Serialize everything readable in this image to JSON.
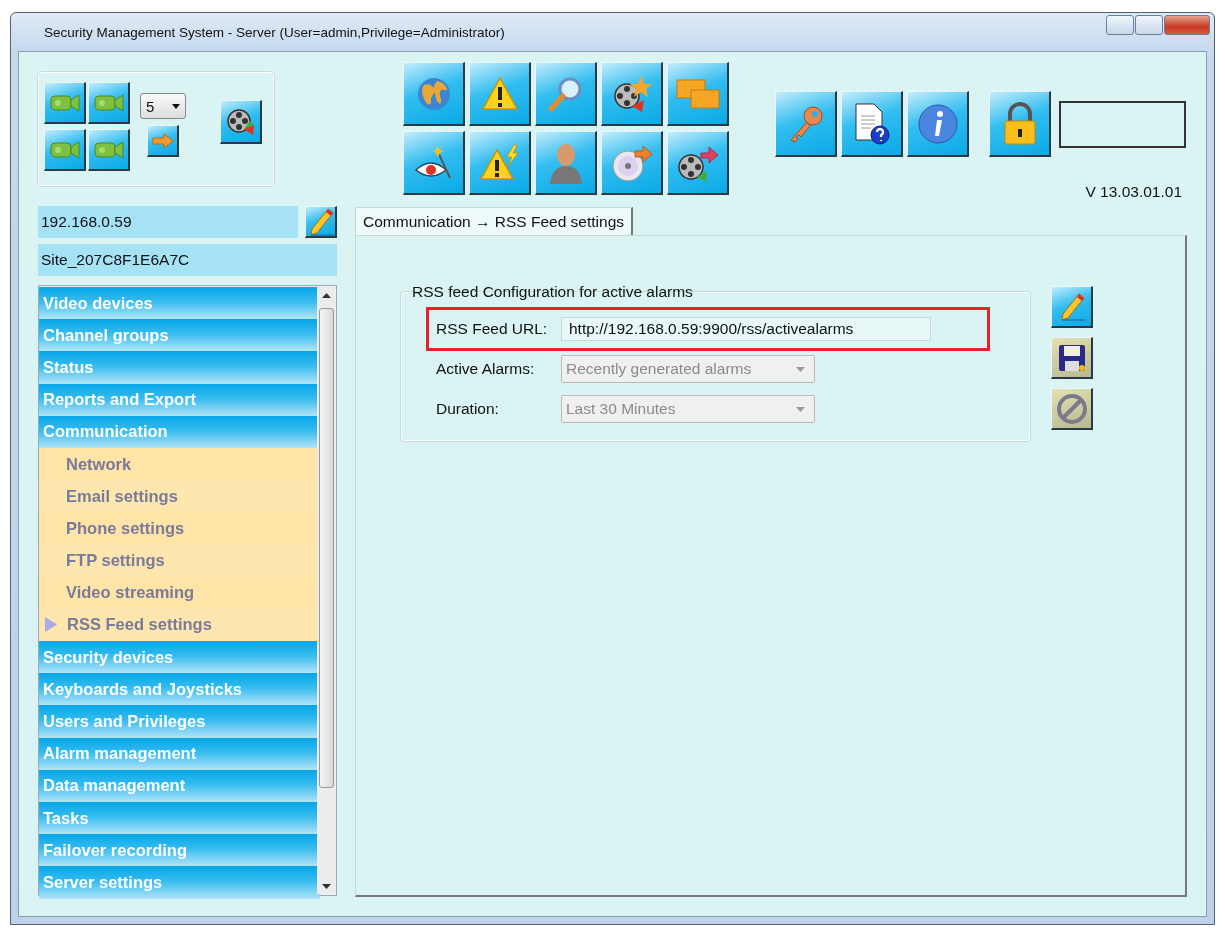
{
  "window": {
    "title": "Security Management System - Server (User=admin,Privilege=Administrator)"
  },
  "view_panel": {
    "layout_count": "5"
  },
  "address": {
    "value": "192.168.0.59"
  },
  "site": {
    "name": "Site_207C8F1E6A7C"
  },
  "version": "V 13.03.01.01",
  "sidebar": {
    "items": [
      {
        "label": "Video devices"
      },
      {
        "label": "Channel groups"
      },
      {
        "label": "Status"
      },
      {
        "label": "Reports and Export"
      },
      {
        "label": "Communication",
        "children": [
          {
            "label": "Network",
            "selected": false
          },
          {
            "label": "Email settings",
            "selected": false
          },
          {
            "label": "Phone settings",
            "selected": false
          },
          {
            "label": "FTP settings",
            "selected": false
          },
          {
            "label": "Video streaming",
            "selected": false
          },
          {
            "label": "RSS Feed settings",
            "selected": true
          }
        ]
      },
      {
        "label": "Security devices"
      },
      {
        "label": "Keyboards and Joysticks"
      },
      {
        "label": "Users and Privileges"
      },
      {
        "label": "Alarm management"
      },
      {
        "label": "Data management"
      },
      {
        "label": "Tasks"
      },
      {
        "label": "Failover recording"
      },
      {
        "label": "Server settings"
      }
    ]
  },
  "tabs": [
    {
      "label": "Communication → RSS Feed settings",
      "selected": true
    }
  ],
  "group": {
    "title": "RSS feed Configuration for active alarms",
    "fields": [
      {
        "kind": "text",
        "label": "RSS Feed URL:",
        "value": "http://192.168.0.59:9900/rss/activealarms",
        "highlighted": true,
        "disabled": false
      },
      {
        "kind": "dropdown",
        "label": "Active Alarms:",
        "value": "Recently generated alarms",
        "highlighted": false,
        "disabled": true
      },
      {
        "kind": "dropdown",
        "label": "Duration:",
        "value": "Last 30 Minutes",
        "highlighted": false,
        "disabled": true
      }
    ]
  },
  "side_buttons": [
    {
      "kind": "edit",
      "disabled": false
    },
    {
      "kind": "save",
      "disabled": true
    },
    {
      "kind": "cancel",
      "disabled": true
    }
  ]
}
